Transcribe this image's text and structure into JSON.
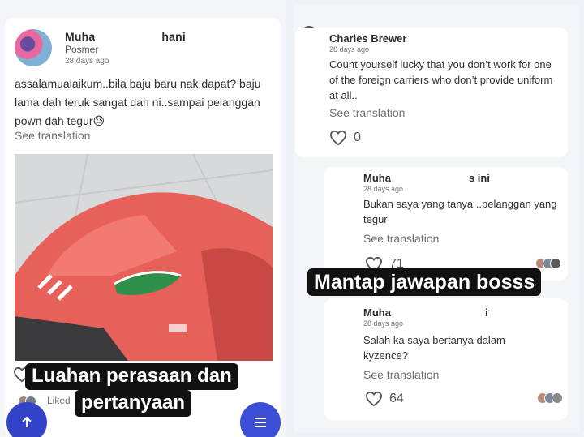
{
  "post": {
    "author": "Muha",
    "author_tail": "hani",
    "group": "Posmer",
    "time": "28 days ago",
    "body": "assalamualaikum..bila baju baru nak dapat? baju lama dah teruk sangat dah ni..sampai pelanggan pown dah tegur😓",
    "see_translation": "See translation",
    "liked_label": "Liked"
  },
  "comments": [
    {
      "author": "Charles Brewer",
      "time": "28 days ago",
      "text": "Count yourself lucky that you don’t work for one of the foreign carriers who don’t provide uniform at all..",
      "see_translation": "See translation",
      "likes": "0"
    },
    {
      "author": "Muha",
      "author_tail": "s ini",
      "time": "28 days ago",
      "text": "Bukan saya yang tanya ..pelanggan yang tegur",
      "see_translation": "See translation",
      "likes": "71"
    },
    {
      "author": "Muha",
      "author_tail": "i",
      "time": "28 days ago",
      "text": "Salah ka saya bertanya dalam kyzence?",
      "see_translation": "See translation",
      "likes": "64"
    }
  ],
  "captions": {
    "line1": "Luahan perasaan dan",
    "line2": "pertanyaan",
    "right": "Mantap jawapan bosss"
  },
  "icons": {
    "up": "arrow-up-icon",
    "menu": "menu-icon",
    "heart": "heart-icon"
  },
  "colors": {
    "fab": "#3343c7",
    "shirt": "#e8605a"
  }
}
